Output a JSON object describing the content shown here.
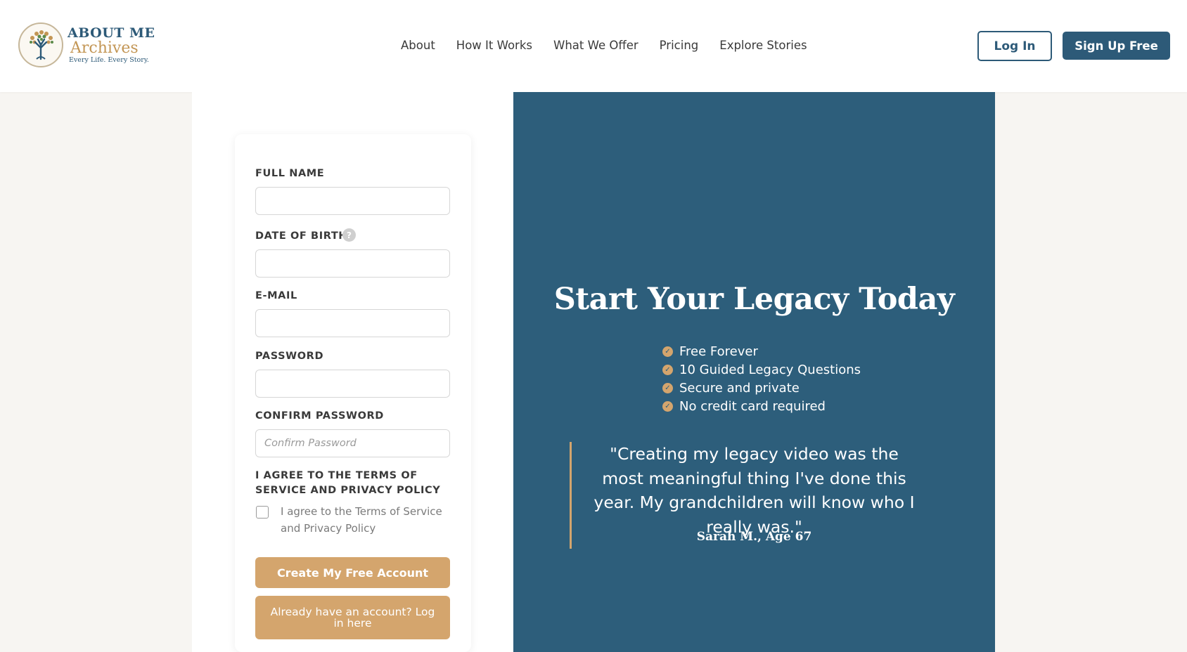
{
  "brand": {
    "name_top": "ABOUT ME",
    "name_bottom": "Archives",
    "tagline": "Every Life. Every Story.",
    "logo_icon": "tree-icon"
  },
  "nav": {
    "items": [
      {
        "label": "About"
      },
      {
        "label": "How It Works"
      },
      {
        "label": "What We Offer"
      },
      {
        "label": "Pricing"
      },
      {
        "label": "Explore Stories"
      }
    ],
    "login_label": "Log In",
    "signup_label": "Sign Up Free"
  },
  "form": {
    "full_name": {
      "label": "FULL NAME",
      "value": "",
      "placeholder": ""
    },
    "dob": {
      "label": "DATE OF BIRTH",
      "value": "",
      "placeholder": "",
      "help_icon": "question-mark-icon",
      "help_glyph": "?"
    },
    "email": {
      "label": "E-MAIL",
      "value": "",
      "placeholder": ""
    },
    "password": {
      "label": "PASSWORD",
      "value": "",
      "placeholder": ""
    },
    "confirm_password": {
      "label": "CONFIRM PASSWORD",
      "value": "",
      "placeholder": "Confirm Password"
    },
    "terms": {
      "label": "I AGREE TO THE TERMS OF SERVICE AND PRIVACY POLICY",
      "checkbox_text": "I agree to the Terms of Service and Privacy Policy",
      "checked": false
    },
    "create_label": "Create My Free Account",
    "existing_label": "Already have an account? Log in here"
  },
  "panel": {
    "title": "Start Your Legacy Today",
    "feature_icon": "check-circle-icon",
    "check_glyph": "✓",
    "features": [
      {
        "label": "Free Forever"
      },
      {
        "label": "10 Guided Legacy Questions"
      },
      {
        "label": "Secure and private"
      },
      {
        "label": "No credit card required"
      }
    ],
    "quote": "\"Creating my legacy video was the most meaningful thing I've done this year. My grandchildren will know who I really was.\"",
    "author": "Sarah M., Age 67"
  },
  "colors": {
    "primary": "#2d5a78",
    "panel_bg": "#2d5e7b",
    "accent": "#d4a56d",
    "page_bg": "#f7f5f2"
  }
}
